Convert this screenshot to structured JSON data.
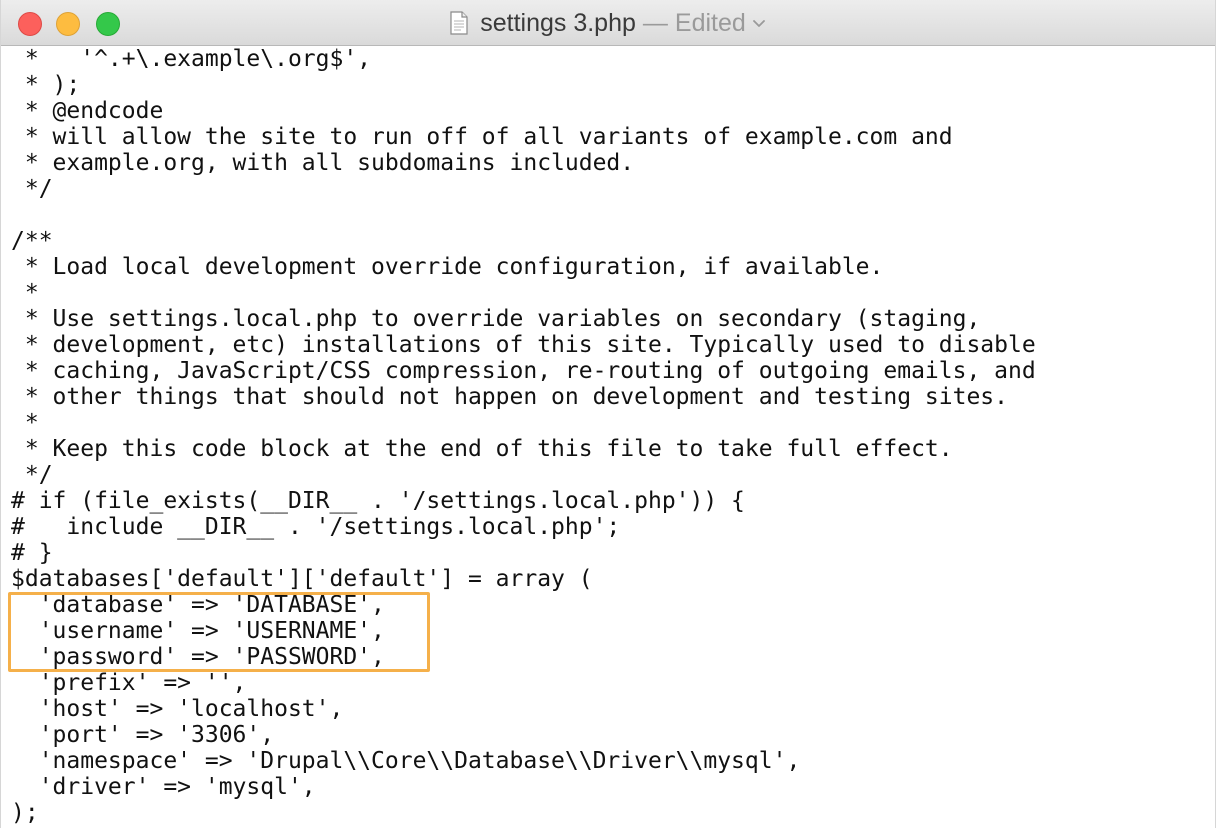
{
  "window": {
    "filename": "settings 3.php",
    "separator": "—",
    "status": "Edited",
    "icons": {
      "close": "close-button",
      "minimize": "minimize-button",
      "zoom": "zoom-button",
      "document": "document-icon",
      "chevron": "chevron-down-icon"
    }
  },
  "highlight": {
    "color": "#f5b04a"
  },
  "code": {
    "lines": [
      " *   '^.+\\.example\\.org$',",
      " * );",
      " * @endcode",
      " * will allow the site to run off of all variants of example.com and",
      " * example.org, with all subdomains included.",
      " */",
      "",
      "/**",
      " * Load local development override configuration, if available.",
      " *",
      " * Use settings.local.php to override variables on secondary (staging,",
      " * development, etc) installations of this site. Typically used to disable",
      " * caching, JavaScript/CSS compression, re-routing of outgoing emails, and",
      " * other things that should not happen on development and testing sites.",
      " *",
      " * Keep this code block at the end of this file to take full effect.",
      " */",
      "# if (file_exists(__DIR__ . '/settings.local.php')) {",
      "#   include __DIR__ . '/settings.local.php';",
      "# }",
      "$databases['default']['default'] = array (",
      "  'database' => 'DATABASE',",
      "  'username' => 'USERNAME',",
      "  'password' => 'PASSWORD',",
      "  'prefix' => '',",
      "  'host' => 'localhost',",
      "  'port' => '3306',",
      "  'namespace' => 'Drupal\\\\Core\\\\Database\\\\Driver\\\\mysql',",
      "  'driver' => 'mysql',",
      ");"
    ]
  }
}
